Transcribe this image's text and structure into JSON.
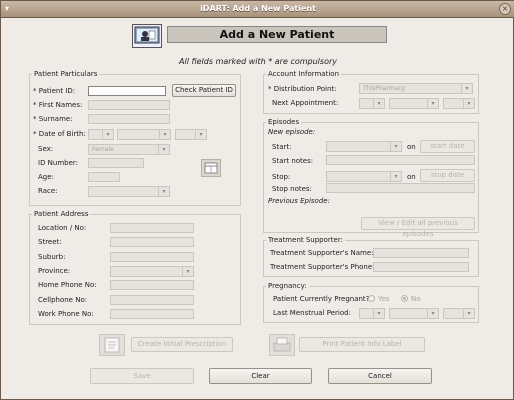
{
  "window": {
    "title": "iDART: Add a New Patient"
  },
  "header": {
    "title": "Add a New Patient",
    "compulsory_note": "All fields marked with * are compulsory"
  },
  "patient_particulars": {
    "title": "Patient Particulars",
    "patient_id_label": "* Patient ID:",
    "check_button": "Check Patient ID",
    "first_names_label": "* First Names:",
    "surname_label": "* Surname:",
    "dob_label": "* Date of Birth:",
    "sex_label": "Sex:",
    "sex_value": "Female",
    "id_number_label": "ID Number:",
    "age_label": "Age:",
    "race_label": "Race:"
  },
  "patient_address": {
    "title": "Patient Address",
    "location_label": "Location / No:",
    "street_label": "Street:",
    "suburb_label": "Suburb:",
    "province_label": "Province:",
    "home_phone_label": "Home Phone No:",
    "cell_phone_label": "Cellphone No:",
    "work_phone_label": "Work Phone No:"
  },
  "account_info": {
    "title": "Account Information",
    "distribution_label": "* Distribution Point:",
    "distribution_value": "ThisPharmacy",
    "next_appt_label": "Next Appointment:"
  },
  "episodes": {
    "title": "Episodes",
    "new_episode": "New episode:",
    "start_label": "Start:",
    "on1": "on",
    "start_date_btn": "start date",
    "start_notes_label": "Start notes:",
    "stop_label": "Stop:",
    "on2": "on",
    "stop_date_btn": "stop date",
    "stop_notes_label": "Stop notes:",
    "previous_episode": "Previous Episode:",
    "view_edit_btn": "View / Edit all previous episodes"
  },
  "treatment_supporter": {
    "title": "Treatment Supporter:",
    "name_label": "Treatment Supporter's Name:",
    "phone_label": "Treatment Supporter's Phone:"
  },
  "pregnancy": {
    "title": "Pregnancy:",
    "pregnant_label": "Patient Currently Pregnant?",
    "yes": "Yes",
    "no": "No",
    "lmp_label": "Last Menstrual Period:"
  },
  "actions": {
    "create_prescription": "Create Initial Prescription",
    "print_label": "Print Patient Info Label",
    "save": "Save",
    "clear": "Clear",
    "cancel": "Cancel"
  }
}
